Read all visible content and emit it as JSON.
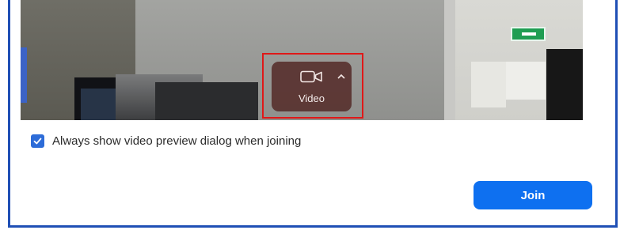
{
  "preview": {
    "video_button": {
      "label": "Video",
      "icon": "video-camera-icon",
      "menu_icon": "chevron-up-icon"
    }
  },
  "options": {
    "always_show_preview": {
      "label": "Always show video preview dialog when joining",
      "checked": true
    }
  },
  "actions": {
    "join_label": "Join"
  },
  "colors": {
    "accent": "#0e70f0",
    "checkbox": "#2d6cd8",
    "highlight_box": "#e01818",
    "window_border": "#1f4fb5",
    "video_button_bg": "#542a28"
  }
}
